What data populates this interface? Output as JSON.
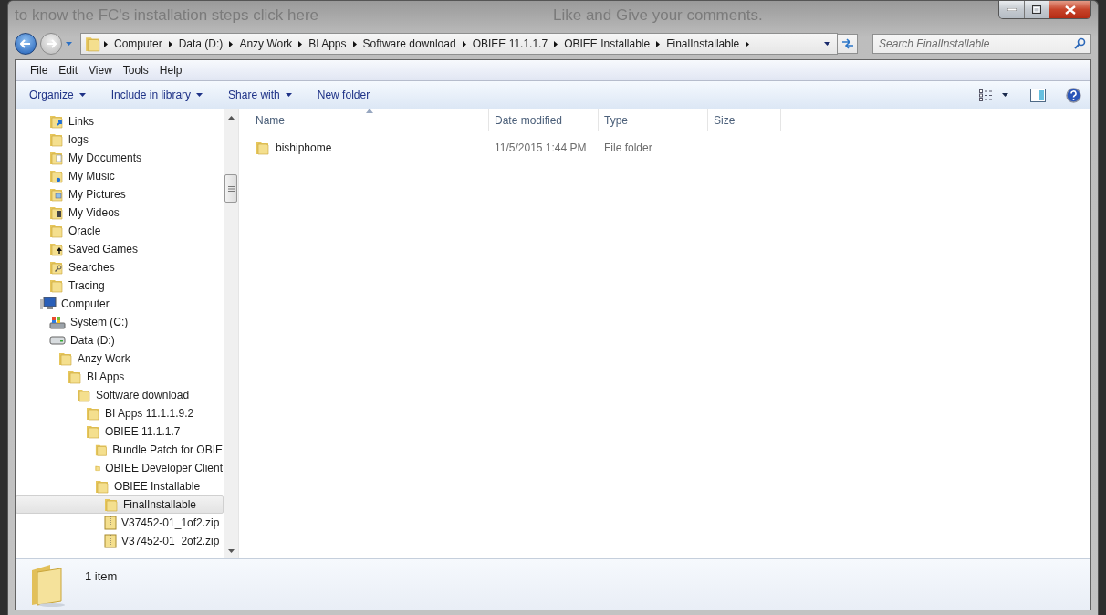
{
  "background_texts": [
    "to know the FC's installation steps click here",
    "Like and Give your comments."
  ],
  "address": {
    "segments": [
      "Computer",
      "Data (D:)",
      "Anzy Work",
      "BI Apps",
      "Software download",
      "OBIEE 11.1.1.7",
      "OBIEE Installable",
      "FinalInstallable"
    ]
  },
  "search": {
    "placeholder": "Search FinalInstallable"
  },
  "menu": [
    "File",
    "Edit",
    "View",
    "Tools",
    "Help"
  ],
  "commands": [
    {
      "label": "Organize",
      "kind": "menu"
    },
    {
      "label": "Include in library",
      "kind": "menu"
    },
    {
      "label": "Share with",
      "kind": "menu"
    },
    {
      "label": "New folder",
      "kind": "plain"
    }
  ],
  "nav": {
    "scrolled_items": [
      {
        "label": "Links",
        "kind": "links",
        "selected": false
      },
      {
        "label": "logs",
        "kind": "folder",
        "selected": false
      },
      {
        "label": "My Documents",
        "kind": "documents",
        "selected": false
      },
      {
        "label": "My Music",
        "kind": "music",
        "selected": false
      },
      {
        "label": "My Pictures",
        "kind": "pictures",
        "selected": false
      },
      {
        "label": "My Videos",
        "kind": "videos",
        "selected": false
      },
      {
        "label": "Oracle",
        "kind": "folder",
        "selected": false
      },
      {
        "label": "Saved Games",
        "kind": "games",
        "selected": false
      },
      {
        "label": "Searches",
        "kind": "searches",
        "selected": false
      },
      {
        "label": "Tracing",
        "kind": "folder",
        "selected": false
      }
    ],
    "tree": [
      {
        "label": "Computer",
        "kind": "computer",
        "selected": false,
        "children": [
          {
            "label": "System (C:)",
            "kind": "system",
            "selected": false
          },
          {
            "label": "Data (D:)",
            "kind": "drive",
            "selected": false,
            "children": [
              {
                "label": "Anzy Work",
                "kind": "folder",
                "selected": false,
                "children": [
                  {
                    "label": "BI Apps",
                    "kind": "folder",
                    "selected": false,
                    "children": [
                      {
                        "label": "Software download",
                        "kind": "folder",
                        "selected": false,
                        "children": [
                          {
                            "label": "BI Apps 11.1.1.9.2",
                            "kind": "folder",
                            "selected": false
                          },
                          {
                            "label": "OBIEE 11.1.1.7",
                            "kind": "folder",
                            "selected": false,
                            "children": [
                              {
                                "label": "Bundle Patch for OBIE",
                                "kind": "folder",
                                "selected": false
                              },
                              {
                                "label": "OBIEE Developer Client",
                                "kind": "folder",
                                "selected": false
                              },
                              {
                                "label": "OBIEE Installable",
                                "kind": "folder",
                                "selected": false,
                                "children": [
                                  {
                                    "label": "FinalInstallable",
                                    "kind": "folder",
                                    "selected": true
                                  },
                                  {
                                    "label": "V37452-01_1of2.zip",
                                    "kind": "zip",
                                    "selected": false
                                  },
                                  {
                                    "label": "V37452-01_2of2.zip",
                                    "kind": "zip",
                                    "selected": false
                                  }
                                ]
                              }
                            ]
                          }
                        ]
                      }
                    ]
                  }
                ]
              }
            ]
          }
        ]
      }
    ]
  },
  "table": {
    "columns": [
      {
        "label": "Name",
        "sorted": true
      },
      {
        "label": "Date modified",
        "sorted": false
      },
      {
        "label": "Type",
        "sorted": false
      },
      {
        "label": "Size",
        "sorted": false
      }
    ],
    "rows": [
      {
        "name": "bishiphome",
        "date_modified": "11/5/2015 1:44 PM",
        "type": "File folder",
        "selected": false
      }
    ]
  },
  "status": {
    "count": "1 item"
  }
}
